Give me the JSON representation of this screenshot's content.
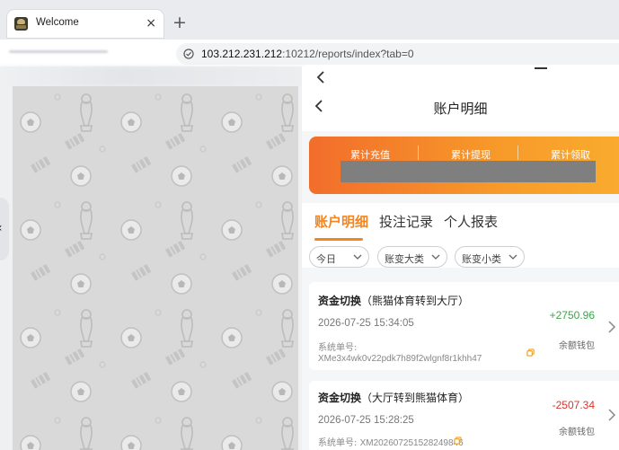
{
  "browser": {
    "tab_title": "Welcome",
    "tab_close": "×",
    "new_tab": "+",
    "url_host": "103.212.231.212",
    "url_rest": ":10212/reports/index?tab=0"
  },
  "page": {
    "header_title": "账户明细",
    "summary": {
      "labels": [
        "累计充值",
        "累计提现",
        "累计领取"
      ]
    },
    "tabs": [
      "账户明细",
      "投注记录",
      "个人报表"
    ],
    "active_tab": 0,
    "filters": [
      "今日",
      "账变大类",
      "账变小类"
    ],
    "records": [
      {
        "type": "资金切换",
        "detail": "（熊猫体育转到大厅）",
        "datetime": "2026-07-25 15:34:05",
        "amount": "+2750.96",
        "wallet": "余额钱包",
        "order_label": "系统单号:",
        "order_no": "XMe3x4wk0v22pdk7h89f2wlgnf8r1khh47"
      },
      {
        "type": "资金切换",
        "detail": "（大厅转到熊猫体育）",
        "datetime": "2026-07-25 15:28:25",
        "amount": "-2507.34",
        "wallet": "余额钱包",
        "order_label": "系统单号:",
        "order_no": "XM202607251528249846"
      }
    ]
  },
  "colors": {
    "accent": "#f5861f",
    "positive": "#3aa64a",
    "negative": "#d9352d"
  }
}
